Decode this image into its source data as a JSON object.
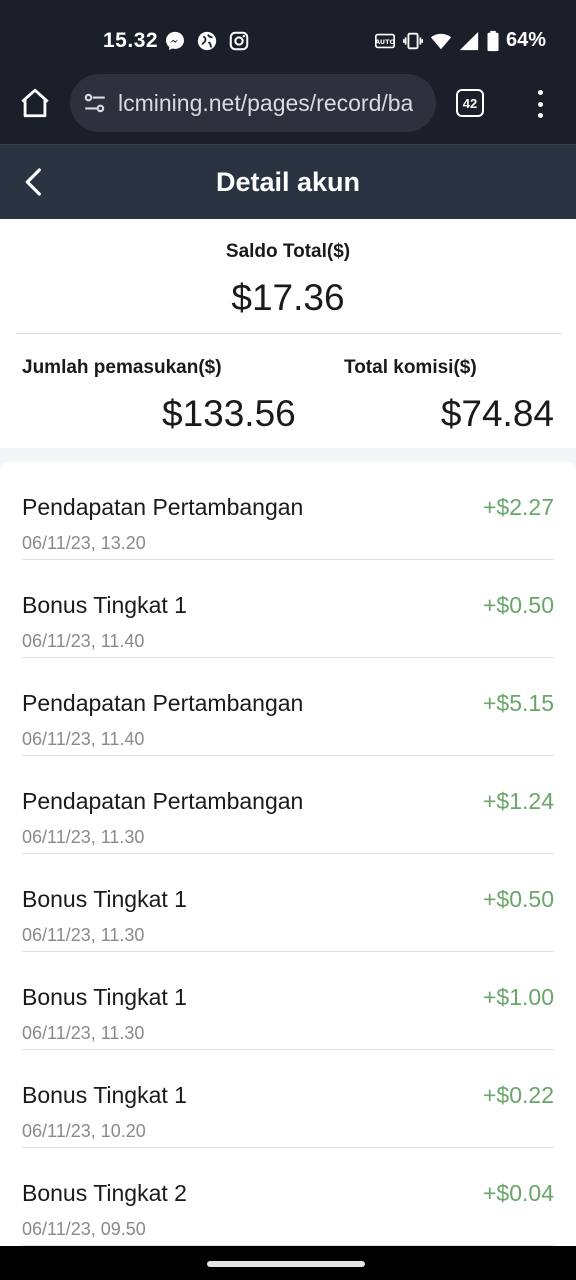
{
  "status_bar": {
    "time": "15.32",
    "left_icons": [
      "messenger-icon",
      "vpn-globe-icon",
      "instagram-icon"
    ],
    "right_icons": [
      "auto-brightness-icon",
      "vibrate-icon",
      "wifi-icon",
      "signal-icon",
      "battery-icon"
    ],
    "battery": "64%"
  },
  "browser": {
    "url": "lcmining.net/pages/record/ba",
    "tab_count": "42"
  },
  "header": {
    "title": "Detail akun"
  },
  "summary": {
    "saldo_label": "Saldo Total($)",
    "saldo_value": "$17.36",
    "income_label": "Jumlah pemasukan($)",
    "income_value": "$133.56",
    "komisi_label": "Total komisi($)",
    "komisi_value": "$74.84"
  },
  "records": [
    {
      "title": "Pendapatan Pertambangan",
      "date": "06/11/23, 13.20",
      "amount": "+$2.27"
    },
    {
      "title": "Bonus Tingkat 1",
      "date": "06/11/23, 11.40",
      "amount": "+$0.50"
    },
    {
      "title": "Pendapatan Pertambangan",
      "date": "06/11/23, 11.40",
      "amount": "+$5.15"
    },
    {
      "title": "Pendapatan Pertambangan",
      "date": "06/11/23, 11.30",
      "amount": "+$1.24"
    },
    {
      "title": "Bonus Tingkat 1",
      "date": "06/11/23, 11.30",
      "amount": "+$0.50"
    },
    {
      "title": "Bonus Tingkat 1",
      "date": "06/11/23, 11.30",
      "amount": "+$1.00"
    },
    {
      "title": "Bonus Tingkat 1",
      "date": "06/11/23, 10.20",
      "amount": "+$0.22"
    },
    {
      "title": "Bonus Tingkat 2",
      "date": "06/11/23, 09.50",
      "amount": "+$0.04"
    }
  ],
  "colors": {
    "header_bg": "#2a3342",
    "status_bg": "#1b1f2a",
    "amount_positive": "#6aa56a"
  }
}
